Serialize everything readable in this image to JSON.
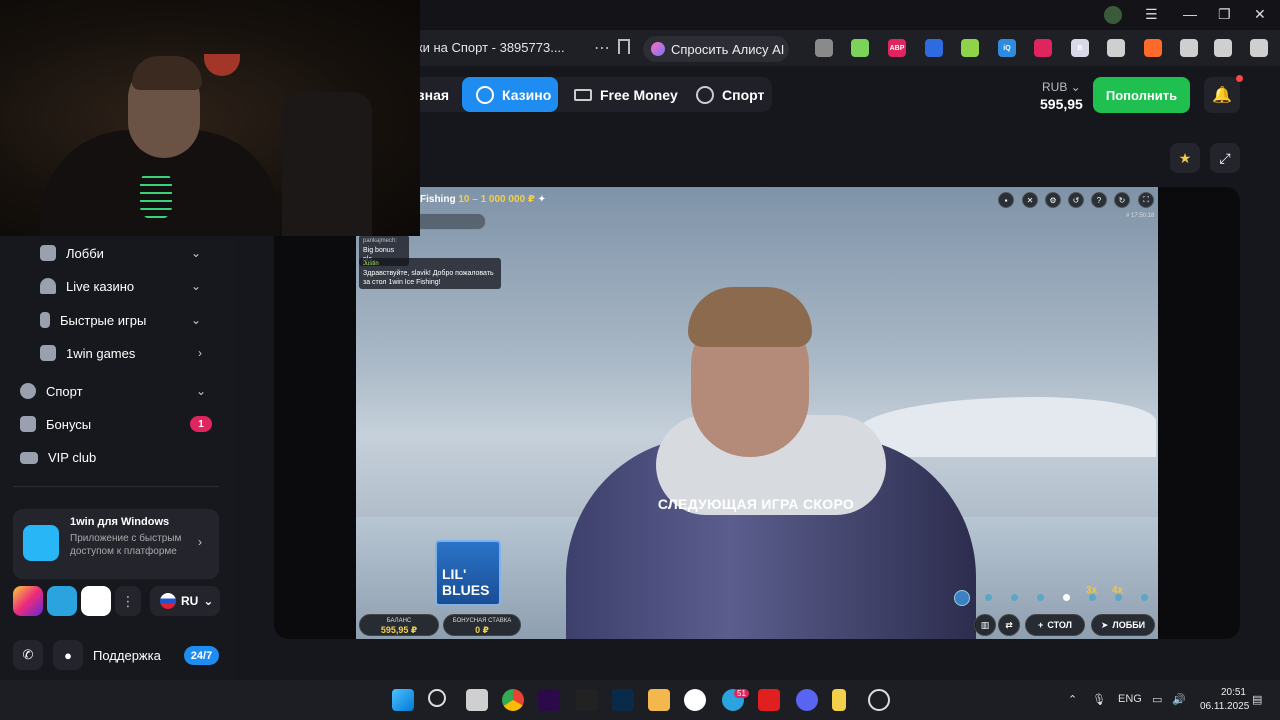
{
  "browser": {
    "address_text": "вки на Спорт - 3895773....",
    "alice_label": "Спросить Алису AI",
    "extensions": [
      {
        "name": "eye-ext-icon",
        "color": "#8a8a8a"
      },
      {
        "name": "chart-ext-icon",
        "color": "#7dd35a"
      },
      {
        "name": "adblock-icon",
        "color": "#e0245e",
        "text": "ABP"
      },
      {
        "name": "shield-ext-icon",
        "color": "#2f6be0"
      },
      {
        "name": "dice-ext-icon",
        "color": "#8fd34a"
      },
      {
        "name": "iq-ext-icon",
        "color": "#2f8be0",
        "text": "iQ"
      },
      {
        "name": "red-ext-icon",
        "color": "#e0245e"
      },
      {
        "name": "b-ext-icon",
        "color": "#d8d8e8",
        "text": "B"
      },
      {
        "name": "glasses-ext-icon",
        "color": "#cfcfcf"
      },
      {
        "name": "fire-ext-icon",
        "color": "#ff6a2a"
      },
      {
        "name": "play-ext-icon",
        "color": "#cfcfcf"
      },
      {
        "name": "translate-ext-icon",
        "color": "#cfcfcf"
      },
      {
        "name": "download-icon",
        "color": "#cfcfcf"
      }
    ]
  },
  "header": {
    "nav": [
      {
        "label": "вная"
      },
      {
        "label": "Казино",
        "active": true
      },
      {
        "label": "Free Money"
      },
      {
        "label": "Спорт"
      }
    ],
    "currency": "RUB",
    "balance": "595,95",
    "deposit_label": "Пополнить"
  },
  "sidebar": {
    "items": [
      {
        "label": "Лобби",
        "chevron": "down"
      },
      {
        "label": "Live казино",
        "chevron": "down"
      },
      {
        "label": "Быстрые игры",
        "chevron": "down"
      },
      {
        "label": "1win games",
        "chevron": "right"
      },
      {
        "label": "Спорт",
        "chevron": "down"
      },
      {
        "label": "Бонусы",
        "badge": "1"
      },
      {
        "label": "VIP club"
      }
    ],
    "app_card": {
      "title": "1win для Windows",
      "subtitle": "Приложение с быстрым доступом к платформе"
    },
    "language": "RU",
    "support_label": "Поддержка",
    "support_badge": "24/7"
  },
  "game": {
    "title_prefix": "Fishing",
    "title_range": "10 – 1 000 000 ₽",
    "time": "# 17:50:18",
    "chat": [
      {
        "name": "pankajmech:",
        "text": "Big bonus pls"
      },
      {
        "name": "Justin",
        "text": "Здравствуйте, slavik! Добро пожаловать за стол 1win Ice Fishing!"
      }
    ],
    "status_text": "СЛЕДУЮЩАЯ ИГРА СКОРО",
    "logo_text_1": "LIL'",
    "logo_text_2": "BLUES",
    "multipliers": [
      "3x",
      "4x"
    ],
    "balance_label": "БАЛАНС",
    "balance_value": "595,95 ₽",
    "bonus_label": "БОНУСНАЯ СТАВКА",
    "bonus_value": "0 ₽",
    "table_label": "СТОЛ",
    "lobby_label": "ЛОББИ"
  },
  "taskbar": {
    "lang": "ENG",
    "time": "20:51",
    "date": "06.11.2025",
    "telegram_badge": "51"
  }
}
